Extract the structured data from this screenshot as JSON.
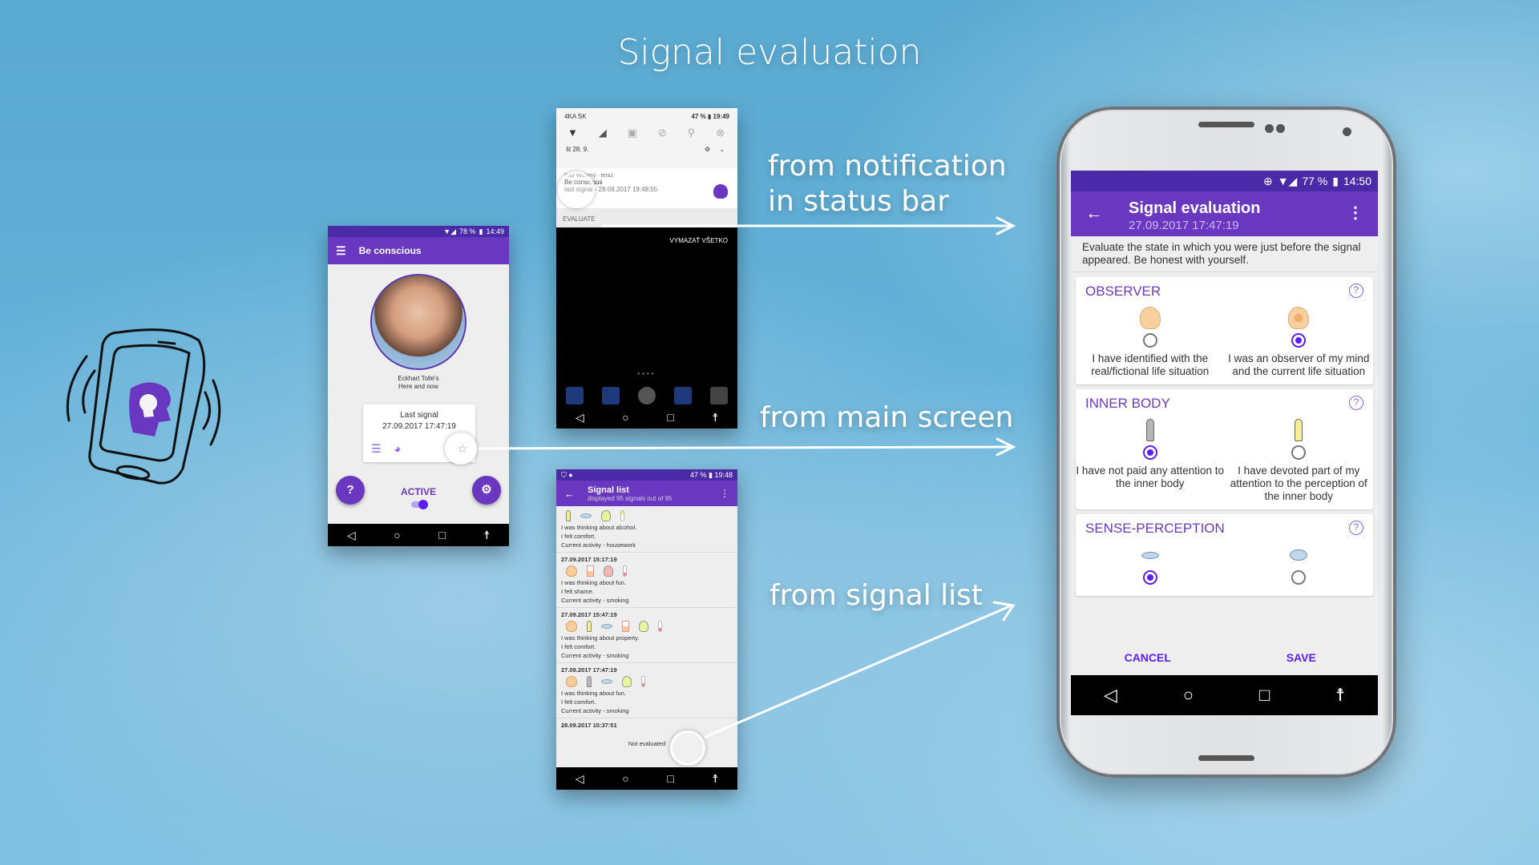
{
  "headline": "Signal evaluation",
  "captions": {
    "notification": [
      "from notification",
      "in status bar"
    ],
    "main_screen": "from main screen",
    "signal_list": "from signal list"
  },
  "main_screen": {
    "status": {
      "battery": "78 %",
      "time": "14:49"
    },
    "title": "Be conscious",
    "author_line1": "Eckhart Tolle's",
    "author_line2": "Here and now",
    "last_signal_label": "Last signal",
    "last_signal_value": "27.09.2017  17:47:19",
    "help_label": "?",
    "status_label": "ACTIVE",
    "switch_on": true
  },
  "notification_screen": {
    "carrier": "4KA SK",
    "battery": "47 %",
    "time": "19:49",
    "date": "št 28. 9.",
    "app_line": "Buď vedomý · teraz",
    "title": "Be conscious",
    "subtitle": "last signal - 28.09.2017  19:48:55",
    "action": "EVALUATE",
    "clear_all": "VYMAZAŤ VŠETKO"
  },
  "signal_list_screen": {
    "status": {
      "battery": "47 %",
      "time": "19:48"
    },
    "title": "Signal list",
    "subtitle": "displayed 95 signals out of 95",
    "items": [
      {
        "date": "",
        "lines": [
          "I was thinking about alcohol.",
          "I felt comfort.",
          "Current activity - housework"
        ]
      },
      {
        "date": "27.09.2017  15:17:19",
        "lines": [
          "I was thinking about fun.",
          "I felt shame.",
          "Current activity - smoking"
        ]
      },
      {
        "date": "27.09.2017  15:47:19",
        "lines": [
          "I was thinking about property.",
          "I felt comfort.",
          "Current activity - smoking"
        ]
      },
      {
        "date": "27.09.2017  17:47:19",
        "lines": [
          "I was thinking about fun.",
          "I felt comfort.",
          "Current activity - smoking"
        ]
      },
      {
        "date": "28.09.2017  15:37:51",
        "lines": [
          "Not evaluated"
        ]
      }
    ]
  },
  "evaluation_screen": {
    "status": {
      "battery": "77 %",
      "time": "14:50"
    },
    "title": "Signal evaluation",
    "subtitle": "27.09.2017  17:47:19",
    "intro": "Evaluate the state in which you were just before the signal appeared. Be honest with yourself.",
    "sections": [
      {
        "title": "OBSERVER",
        "options": [
          {
            "label": "I have identified with the real/fictional life situation",
            "selected": false
          },
          {
            "label": "I was an observer of my mind and the current life situation",
            "selected": true
          }
        ]
      },
      {
        "title": "INNER BODY",
        "options": [
          {
            "label": "I have not paid any attention to the inner body",
            "selected": true
          },
          {
            "label": "I have devoted part of my attention to the perception of the inner body",
            "selected": false
          }
        ]
      },
      {
        "title": "SENSE-PERCEPTION",
        "options": [
          {
            "label": "",
            "selected": true
          },
          {
            "label": "",
            "selected": false
          }
        ]
      }
    ],
    "help_label": "?",
    "cancel": "CANCEL",
    "save": "SAVE"
  },
  "colors": {
    "primary": "#6a38c0",
    "primary_dark": "#4a2aa6",
    "accent": "#5b1ff5",
    "section_title": "#6a3bbd"
  }
}
